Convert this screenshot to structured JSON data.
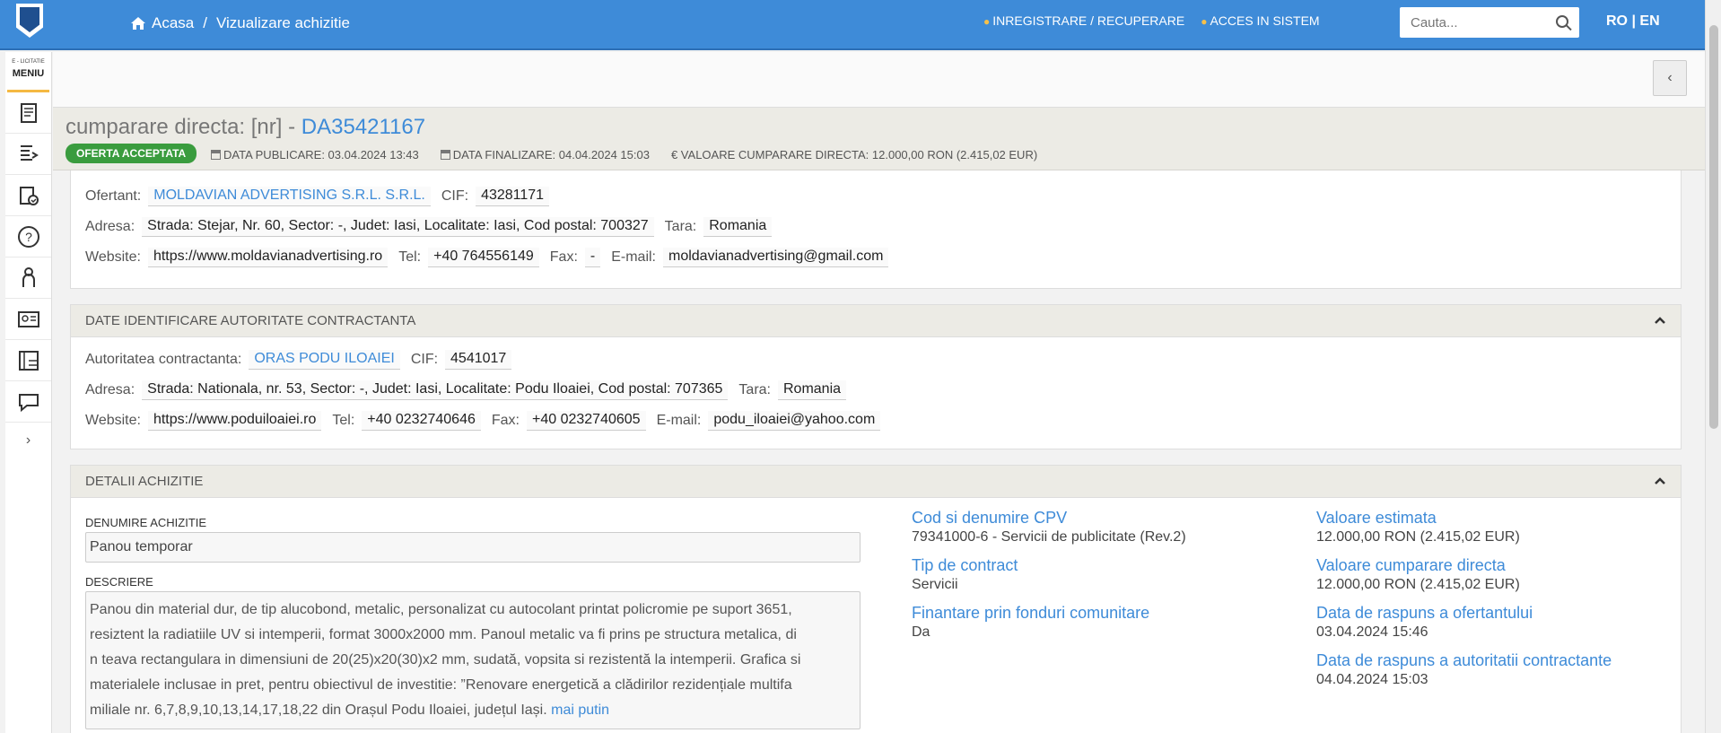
{
  "topbar": {
    "breadcrumb": {
      "home": "Acasa",
      "separator": "/",
      "current": "Vizualizare achizitie"
    },
    "links": {
      "register": "INREGISTRARE / RECUPERARE",
      "login": "ACCES IN SISTEM"
    },
    "search_placeholder": "Cauta...",
    "lang": {
      "ro": "RO",
      "sep": "|",
      "en": "EN"
    }
  },
  "sidebar": {
    "subtitle": "E - LICITATIE",
    "title": "MENIU",
    "items": [
      "document-icon",
      "document-arrow-icon",
      "clipboard-check-icon",
      "help-icon",
      "user-icon",
      "id-card-icon",
      "catalog-icon",
      "chat-icon"
    ]
  },
  "header": {
    "title_prefix": "cumparare directa: [nr] - ",
    "code": "DA35421167",
    "badge": "OFERTA ACCEPTATA",
    "published": "DATA PUBLICARE: 03.04.2024 13:43",
    "finalized": "DATA FINALIZARE: 04.04.2024 15:03",
    "value": "€ VALOARE CUMPARARE DIRECTA: 12.000,00  RON (2.415,02  EUR)"
  },
  "offerer": {
    "name_label": "Ofertant:",
    "name": "MOLDAVIAN ADVERTISING S.R.L. S.R.L.",
    "cif_label": "CIF:",
    "cif": "43281171",
    "address_label": "Adresa:",
    "address": "Strada: Stejar, Nr. 60, Sector: -, Judet: Iasi, Localitate: Iasi, Cod postal: 700327",
    "country_label": "Tara:",
    "country": "Romania",
    "website_label": "Website:",
    "website": "https://www.moldavianadvertising.ro",
    "tel_label": "Tel:",
    "tel": "+40 764556149",
    "fax_label": "Fax:",
    "fax": "-",
    "email_label": "E-mail:",
    "email": "moldavianadvertising@gmail.com"
  },
  "authority": {
    "heading": "DATE IDENTIFICARE AUTORITATE CONTRACTANTA",
    "name_label": "Autoritatea contractanta:",
    "name": "ORAS PODU ILOAIEI",
    "cif_label": "CIF:",
    "cif": "4541017",
    "address_label": "Adresa:",
    "address": "Strada: Nationala, nr. 53, Sector: -, Judet: Iasi, Localitate: Podu Iloaiei, Cod postal: 707365",
    "country_label": "Tara:",
    "country": "Romania",
    "website_label": "Website:",
    "website": "https://www.poduiloaiei.ro",
    "tel_label": "Tel:",
    "tel": "+40 0232740646",
    "fax_label": "Fax:",
    "fax": "+40 0232740605",
    "email_label": "E-mail:",
    "email": "podu_iloaiei@yahoo.com"
  },
  "details": {
    "heading": "DETALII ACHIZITIE",
    "name_label": "DENUMIRE ACHIZITIE",
    "name": "Panou temporar",
    "desc_label": "DESCRIERE",
    "desc_lines": [
      "Panou din material dur, de tip alucobond, metalic, personalizat cu autocolant printat policromie pe suport 3651,",
      "resiztent la radiatiile UV si intemperii, format 3000x2000 mm. Panoul metalic va fi prins pe structura metalica, di",
      "n teava rectangulara in dimensiuni de 20(25)x20(30)x2 mm, sudată, vopsita si rezistentă la intemperii. Grafica si",
      "materialele inclusae in pret, pentru obiectivul de investitie: ”Renovare energetică a clădirilor rezidențiale multifa",
      "miliale nr. 6,7,8,9,10,13,14,17,18,22 din Orașul Podu Iloaiei, județul Iași."
    ],
    "desc_more": "mai putin",
    "cpv_label": "Cod si denumire CPV",
    "cpv": "79341000-6 - Servicii de publicitate (Rev.2)",
    "contract_label": "Tip de contract",
    "contract": "Servicii",
    "funding_label": "Finantare prin fonduri comunitare",
    "funding": "Da",
    "est_label": "Valoare estimata",
    "est": "12.000,00  RON (2.415,02  EUR)",
    "direct_label": "Valoare cumparare directa",
    "direct": "12.000,00  RON (2.415,02  EUR)",
    "offer_resp_label": "Data de raspuns a ofertantului",
    "offer_resp": "03.04.2024 15:46",
    "auth_resp_label": "Data de raspuns a autoritatii contractante",
    "auth_resp": "04.04.2024 15:03"
  }
}
